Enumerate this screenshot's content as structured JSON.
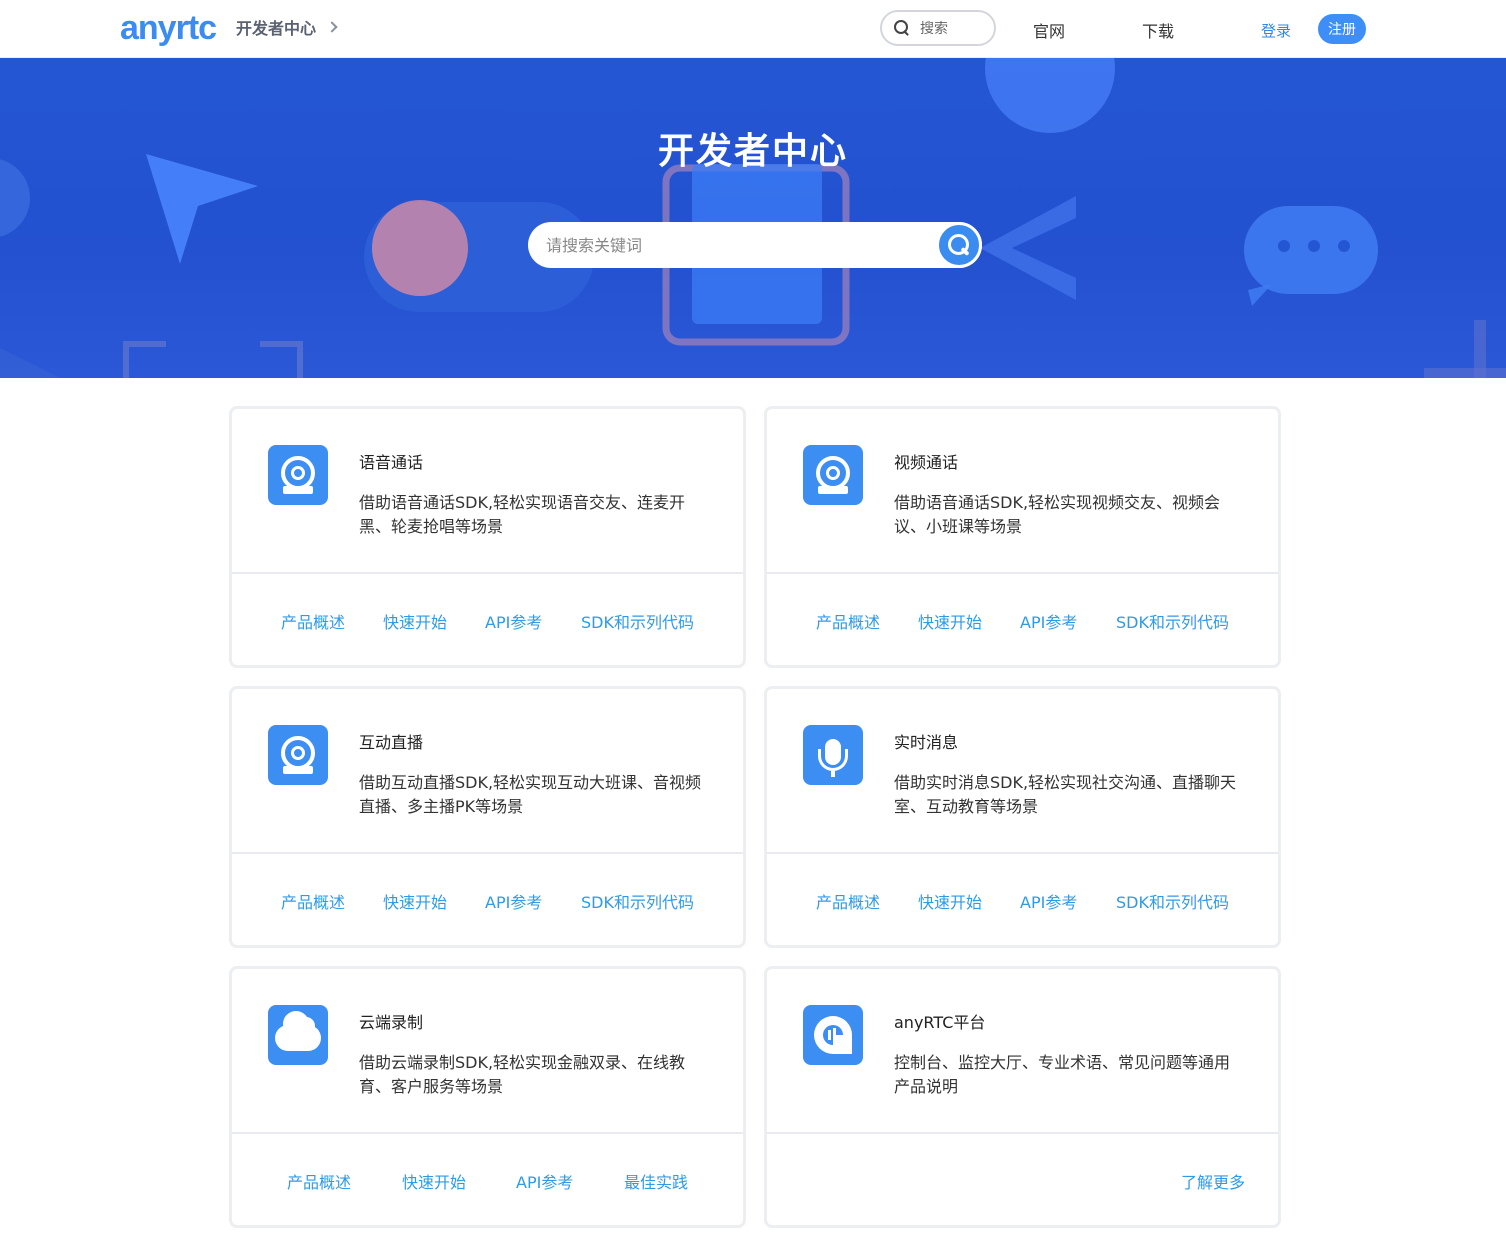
{
  "brand": {
    "logo": "anyrtc",
    "section": "开发者中心"
  },
  "topnav": {
    "search_placeholder": "搜索",
    "links": [
      "官网",
      "下载"
    ],
    "login": "登录",
    "register": "注册"
  },
  "hero": {
    "title": "开发者中心",
    "search_placeholder": "请搜索关键词"
  },
  "colors": {
    "brand_blue": "#3d8ef3",
    "banner": "#2456d4",
    "link": "#2e9be6"
  },
  "cards": [
    {
      "icon": "camera-icon",
      "title": "语音通话",
      "desc": "借助语音通话SDK,轻松实现语音交友、连麦开黑、轮麦抢唱等场景",
      "links": [
        "产品概述",
        "快速开始",
        "API参考",
        "SDK和示列代码"
      ]
    },
    {
      "icon": "camera-icon",
      "title": "视频通话",
      "desc": "借助语音通话SDK,轻松实现视频交友、视频会议、小班课等场景",
      "links": [
        "产品概述",
        "快速开始",
        "API参考",
        "SDK和示列代码"
      ]
    },
    {
      "icon": "camera-icon",
      "title": "互动直播",
      "desc": "借助互动直播SDK,轻松实现互动大班课、音视频直播、多主播PK等场景",
      "links": [
        "产品概述",
        "快速开始",
        "API参考",
        "SDK和示列代码"
      ]
    },
    {
      "icon": "microphone-icon",
      "title": "实时消息",
      "desc": "借助实时消息SDK,轻松实现社交沟通、直播聊天室、互动教育等场景",
      "links": [
        "产品概述",
        "快速开始",
        "API参考",
        "SDK和示列代码"
      ]
    },
    {
      "icon": "cloud-icon",
      "title": "云端录制",
      "desc": "借助云端录制SDK,轻松实现金融双录、在线教育、客户服务等场景",
      "links": [
        "产品概述",
        "快速开始",
        "API参考",
        "最佳实践"
      ]
    },
    {
      "icon": "platform-icon",
      "title": "anyRTC平台",
      "desc": "控制台、监控大厅、专业术语、常见问题等通用产品说明",
      "links": [
        "了解更多"
      ]
    }
  ]
}
